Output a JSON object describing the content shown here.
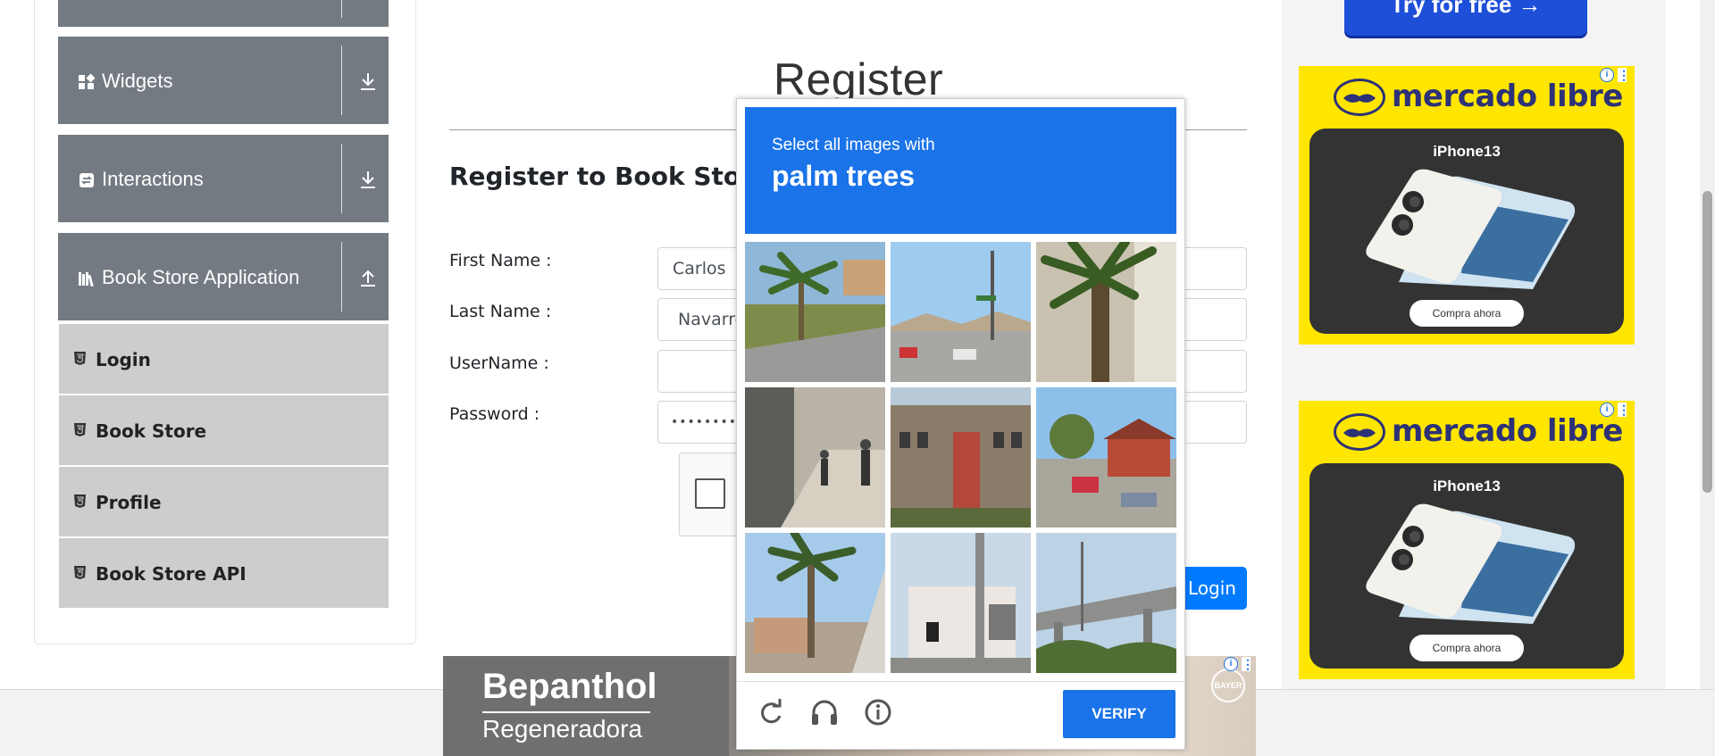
{
  "sidebar": {
    "groups": [
      {
        "label": "Widgets",
        "icon": "widgets-icon",
        "arrow": "download-arrow-icon"
      },
      {
        "label": "Interactions",
        "icon": "interactions-icon",
        "arrow": "download-arrow-icon"
      },
      {
        "label": "Book Store Application",
        "icon": "books-icon",
        "arrow": "upload-arrow-icon"
      }
    ],
    "items": [
      {
        "label": "Login",
        "icon": "html5-icon"
      },
      {
        "label": "Book Store",
        "icon": "html5-icon"
      },
      {
        "label": "Profile",
        "icon": "html5-icon"
      },
      {
        "label": "Book Store API",
        "icon": "html5-icon"
      }
    ]
  },
  "form": {
    "title": "Register",
    "subtitle": "Register to Book Store",
    "fields": [
      {
        "label": "First Name :",
        "value": "Carlos"
      },
      {
        "label": "Last Name :",
        "value": "Navarre"
      },
      {
        "label": "UserName :",
        "value": ""
      },
      {
        "label": "Password :",
        "value": "••••••••"
      }
    ],
    "login_label": "Login"
  },
  "captcha": {
    "instruction": "Select all images with",
    "target": "palm trees",
    "verify_label": "VERIFY",
    "tools": [
      "reload-icon",
      "audio-headphones-icon",
      "info-icon"
    ],
    "tiles": 9
  },
  "ads": {
    "try_free": "Try for free →",
    "mercado_brand": "mercado libre",
    "mercado_model": "iPhone13",
    "mercado_cta": "Compra ahora",
    "bepanthol_brand": "Bepanthol",
    "bepanthol_sub": "Regeneradora",
    "bayer_logo": "BAYER"
  },
  "colors": {
    "sidebar_group": "#737a82",
    "sidebar_item": "#cdcdcd",
    "captcha_blue": "#1a73e8",
    "login_blue": "#007bff",
    "mercado_yellow": "#ffe600"
  }
}
